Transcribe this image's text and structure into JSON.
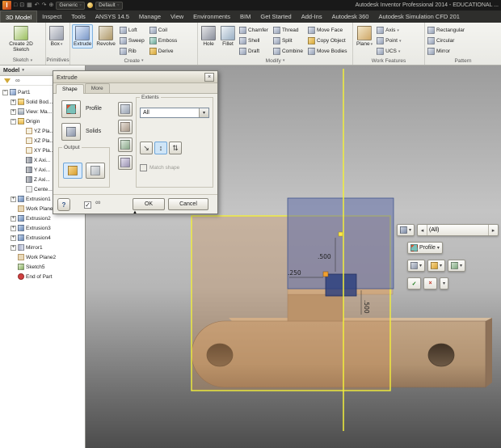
{
  "icons": {
    "logo": "I",
    "qat": [
      "□",
      "⊡",
      "▦",
      "↶",
      "↷",
      "⊕"
    ],
    "dropdown": "▾",
    "spin_left": "◂",
    "spin_right": "▸",
    "check": "✓",
    "cross": "×",
    "help": "?",
    "glasses": "∞",
    "expander": "▲",
    "dir1": "↘",
    "dir2": "↕",
    "dir3": "⇅",
    "search": "∞"
  },
  "titlebar": {
    "material": "Generic",
    "appearance": "Default",
    "title": "Autodesk Inventor Professional 2014 - EDUCATIONAL ..."
  },
  "menubar": {
    "tabs": [
      "3D Model",
      "Inspect",
      "Tools",
      "ANSYS 14.5",
      "Manage",
      "View",
      "Environments",
      "BIM",
      "Get Started",
      "Add-Ins",
      "Autodesk 360",
      "Autodesk Simulation CFD 201"
    ]
  },
  "ribbon": {
    "sketch": {
      "label": "Sketch",
      "create2d": "Create 2D Sketch"
    },
    "primitives": {
      "label": "Primitives",
      "box": "Box"
    },
    "create": {
      "label": "Create",
      "extrude": "Extrude",
      "revolve": "Revolve",
      "small": [
        "Loft",
        "Sweep",
        "Rib",
        "Coil",
        "Emboss",
        "Derive"
      ]
    },
    "modify": {
      "label": "Modify",
      "hole": "Hole",
      "fillet": "Fillet",
      "small": [
        "Chamfer",
        "Shell",
        "Draft",
        "Thread",
        "Split",
        "Combine",
        "Move Face",
        "Copy Object",
        "Move Bodies"
      ]
    },
    "work_features": {
      "label": "Work Features",
      "plane": "Plane",
      "small": [
        "Axis",
        "Point",
        "UCS"
      ]
    },
    "pattern": {
      "label": "Pattern",
      "small": [
        "Rectangular",
        "Circular",
        "Mirror"
      ]
    }
  },
  "dialog": {
    "title": "Extrude",
    "tab_shape": "Shape",
    "tab_more": "More",
    "profile": "Profile",
    "solids": "Solids",
    "output": "Output",
    "extents": "Extents",
    "extents_value": "All",
    "match_shape": "Match shape",
    "ok": "OK",
    "cancel": "Cancel"
  },
  "browser": {
    "header": "Model",
    "tree": [
      {
        "label": "Part1",
        "exp": "−",
        "icon": "part-icon"
      },
      {
        "label": "Solid Bod...",
        "exp": "+",
        "icon": "folder-icon"
      },
      {
        "label": "View: Ma...",
        "exp": "+",
        "icon": "view-icon"
      },
      {
        "label": "Origin",
        "exp": "−",
        "icon": "folder-icon"
      },
      {
        "label": "YZ Pla...",
        "exp": "",
        "icon": "plane-icon"
      },
      {
        "label": "XZ Pla...",
        "exp": "",
        "icon": "plane-icon"
      },
      {
        "label": "XY Pla...",
        "exp": "",
        "icon": "plane-icon"
      },
      {
        "label": "X Axi...",
        "exp": "",
        "icon": "axis-icon"
      },
      {
        "label": "Y Axi...",
        "exp": "",
        "icon": "axis-icon"
      },
      {
        "label": "Z Axi...",
        "exp": "",
        "icon": "axis-icon"
      },
      {
        "label": "Cente...",
        "exp": "",
        "icon": "center-point-icon"
      },
      {
        "label": "Extrusion1",
        "exp": "+",
        "icon": "extrusion-icon"
      },
      {
        "label": "Work Plane1",
        "exp": "",
        "icon": "work-plane-icon"
      },
      {
        "label": "Extrusion2",
        "exp": "+",
        "icon": "extrusion-icon"
      },
      {
        "label": "Extrusion3",
        "exp": "+",
        "icon": "extrusion-icon"
      },
      {
        "label": "Extrusion4",
        "exp": "+",
        "icon": "extrusion-icon"
      },
      {
        "label": "Mirror1",
        "exp": "+",
        "icon": "mirror-icon"
      },
      {
        "label": "Work Plane2",
        "exp": "",
        "icon": "work-plane-icon"
      },
      {
        "label": "Sketch5",
        "exp": "",
        "icon": "sketch-icon"
      },
      {
        "label": "End of Part",
        "exp": "",
        "icon": "end-of-part-icon"
      }
    ]
  },
  "viewport": {
    "dims": {
      "d1": ".500",
      "d2": ".250",
      "d3": ".500"
    },
    "minibar": {
      "extents": "(All)",
      "profile": "Profile"
    }
  },
  "colors": {
    "plane_yellow": "#f2ef3a",
    "profile_blue": "#5f6eaa",
    "part_tan": "#b4977b",
    "selection_blue": "#d8eafc"
  }
}
